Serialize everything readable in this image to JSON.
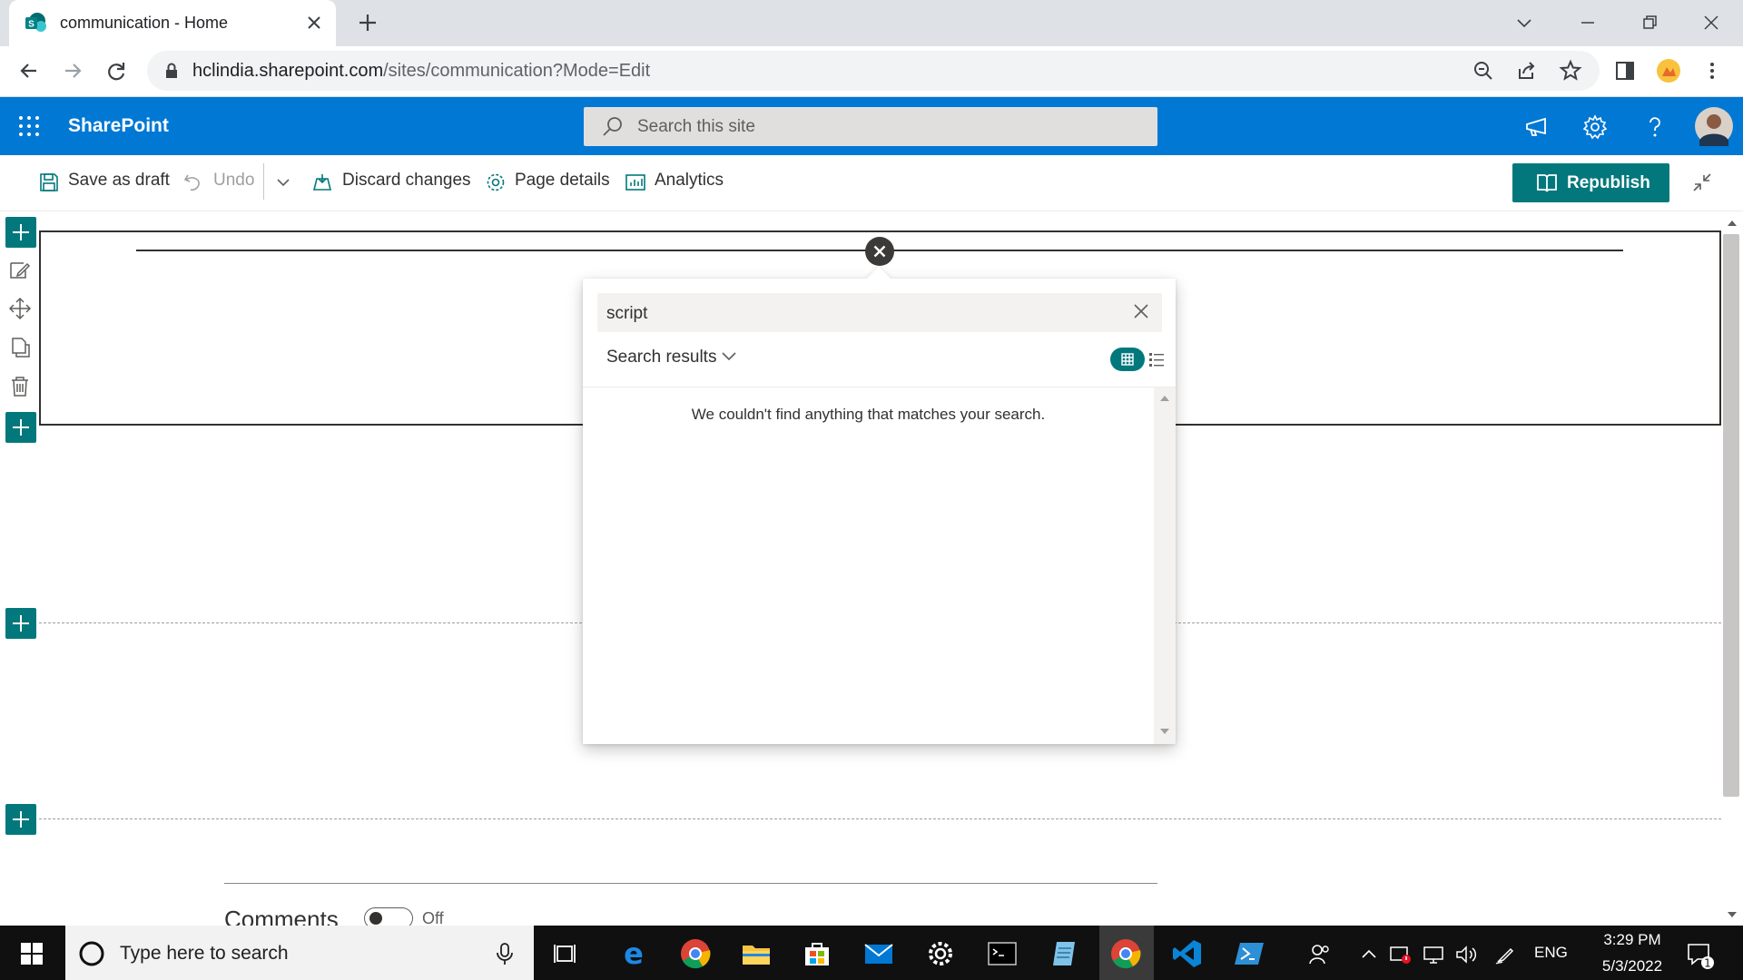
{
  "browser": {
    "tab_title": "communication - Home",
    "url_host": "hclindia.sharepoint.com",
    "url_path": "/sites/communication?Mode=Edit"
  },
  "suite": {
    "app_name": "SharePoint",
    "search_placeholder": "Search this site"
  },
  "commands": {
    "save_draft": "Save as draft",
    "undo": "Undo",
    "discard": "Discard changes",
    "page_details": "Page details",
    "analytics": "Analytics",
    "republish": "Republish"
  },
  "picker": {
    "search_value": "script",
    "filter_label": "Search results",
    "empty_message": "We couldn't find anything that matches your search."
  },
  "comments": {
    "label": "Comments",
    "toggle_state": "Off"
  },
  "taskbar": {
    "search_placeholder": "Type here to search",
    "language": "ENG",
    "time": "3:29 PM",
    "date": "5/3/2022"
  },
  "colors": {
    "suite_blue": "#0078d4",
    "teal_accent": "#03787c",
    "taskbar": "#101010"
  }
}
